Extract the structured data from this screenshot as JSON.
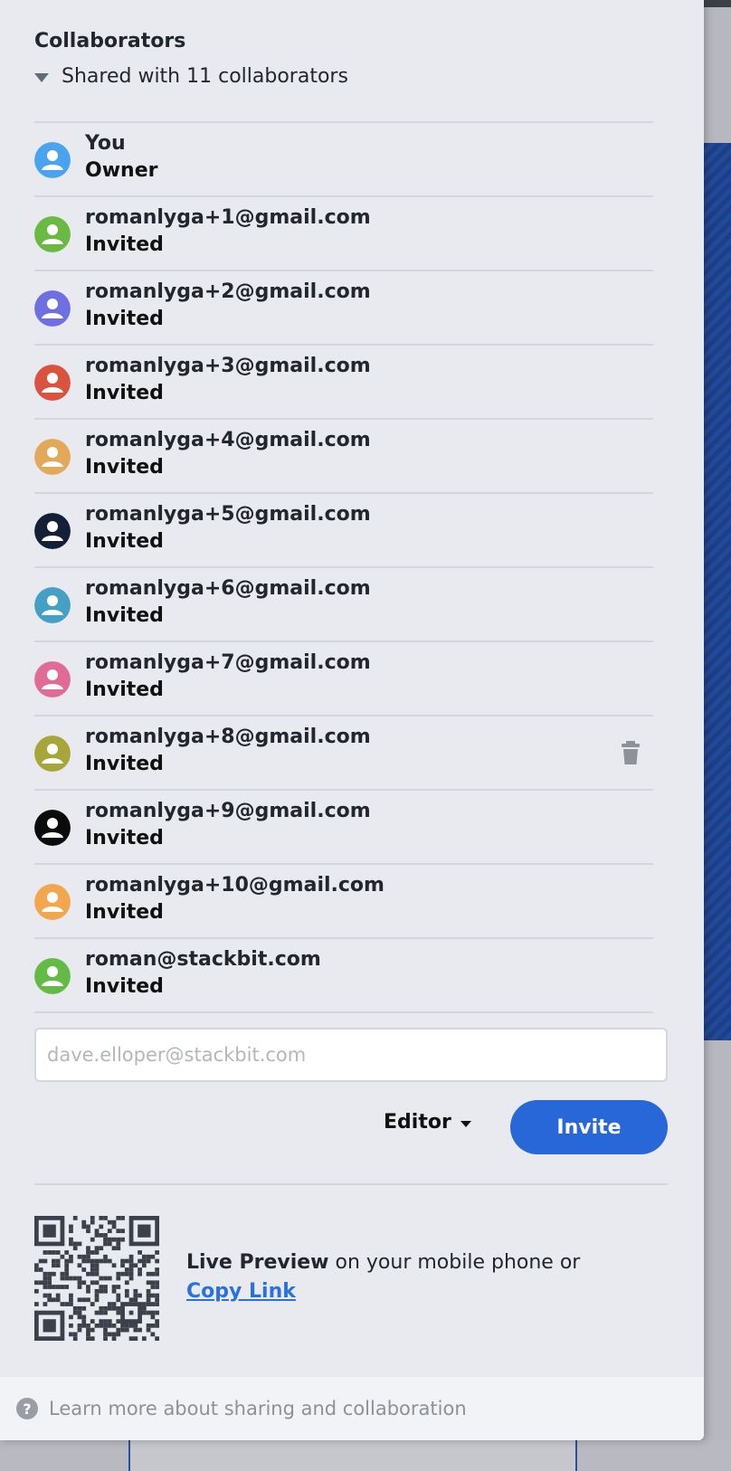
{
  "panel": {
    "title": "Collaborators",
    "summary": "Shared with 11 collaborators"
  },
  "collaborators": [
    {
      "name": "You",
      "status": "Owner",
      "color": "#4aa3ef"
    },
    {
      "name": "romanlyga+1@gmail.com",
      "status": "Invited",
      "color": "#6ab943"
    },
    {
      "name": "romanlyga+2@gmail.com",
      "status": "Invited",
      "color": "#6e6fe0"
    },
    {
      "name": "romanlyga+3@gmail.com",
      "status": "Invited",
      "color": "#d9533f"
    },
    {
      "name": "romanlyga+4@gmail.com",
      "status": "Invited",
      "color": "#e3a95b"
    },
    {
      "name": "romanlyga+5@gmail.com",
      "status": "Invited",
      "color": "#142036"
    },
    {
      "name": "romanlyga+6@gmail.com",
      "status": "Invited",
      "color": "#45a0c6"
    },
    {
      "name": "romanlyga+7@gmail.com",
      "status": "Invited",
      "color": "#e06c95"
    },
    {
      "name": "romanlyga+8@gmail.com",
      "status": "Invited",
      "color": "#a6a63a",
      "show_delete": true
    },
    {
      "name": "romanlyga+9@gmail.com",
      "status": "Invited",
      "color": "#0b0b0b"
    },
    {
      "name": "romanlyga+10@gmail.com",
      "status": "Invited",
      "color": "#f2a64d"
    },
    {
      "name": "roman@stackbit.com",
      "status": "Invited",
      "color": "#63bb45"
    }
  ],
  "invite": {
    "placeholder": "dave.elloper@stackbit.com",
    "role": "Editor",
    "button": "Invite"
  },
  "preview": {
    "bold": "Live Preview",
    "text": " on your mobile phone or",
    "link": "Copy Link"
  },
  "footer": {
    "help_icon": "?",
    "text": "Learn more about sharing and collaboration"
  },
  "colors": {
    "accent": "#2767d7",
    "link": "#2b70e0",
    "panel_bg": "#e9eaf0"
  },
  "icons": {
    "summary_toggle": "triangle-down-icon",
    "delete": "trash-icon",
    "help": "question-circle-icon",
    "avatar": "person-icon"
  }
}
